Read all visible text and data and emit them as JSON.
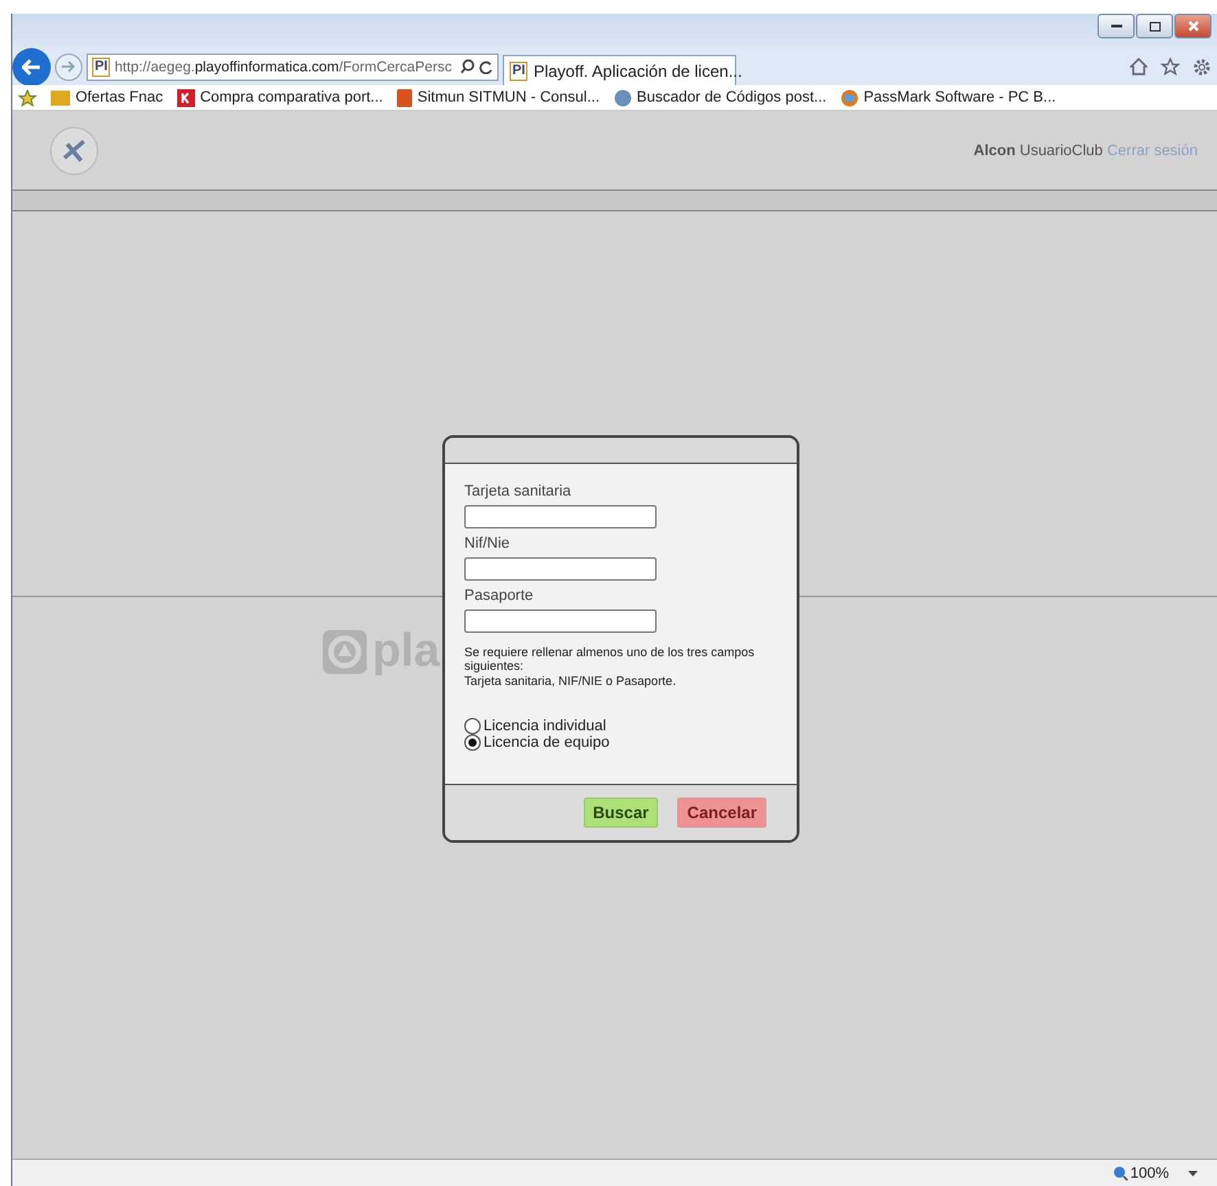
{
  "browser": {
    "address": {
      "prefix": "http://aegeg.",
      "domain": "playoffinformatica.com",
      "path": "/FormCercaPersc"
    },
    "tabs": [
      {
        "label": "Playoff. Aplicación de licen...",
        "selected": true
      }
    ],
    "favorites": [
      {
        "label": "Ofertas Fnac"
      },
      {
        "label": "Compra comparativa port..."
      },
      {
        "label": "Sitmun  SITMUN - Consul..."
      },
      {
        "label": "Buscador de Códigos post..."
      },
      {
        "label": "PassMark Software - PC B..."
      }
    ],
    "favicon_text": "PI",
    "tab_favicon_text": "PI",
    "zoom": "100%"
  },
  "header": {
    "user": "Alcon",
    "club": "UsuarioClub",
    "logout": "Cerrar sesión"
  },
  "background_logo": "pla",
  "dialog": {
    "fields": [
      {
        "label": "Tarjeta sanitaria"
      },
      {
        "label": "Nif/Nie"
      },
      {
        "label": "Pasaporte"
      }
    ],
    "note": "Se requiere rellenar almenos uno de los tres campos siguientes:\nTarjeta sanitaria, NIF/NIE o Pasaporte.",
    "options": [
      {
        "label": "Licencia individual",
        "selected": false
      },
      {
        "label": "Licencia de equipo",
        "selected": true
      }
    ],
    "buttons": [
      {
        "label": "Buscar",
        "kind": "primary"
      },
      {
        "label": "Cancelar",
        "kind": "cancel"
      }
    ]
  }
}
